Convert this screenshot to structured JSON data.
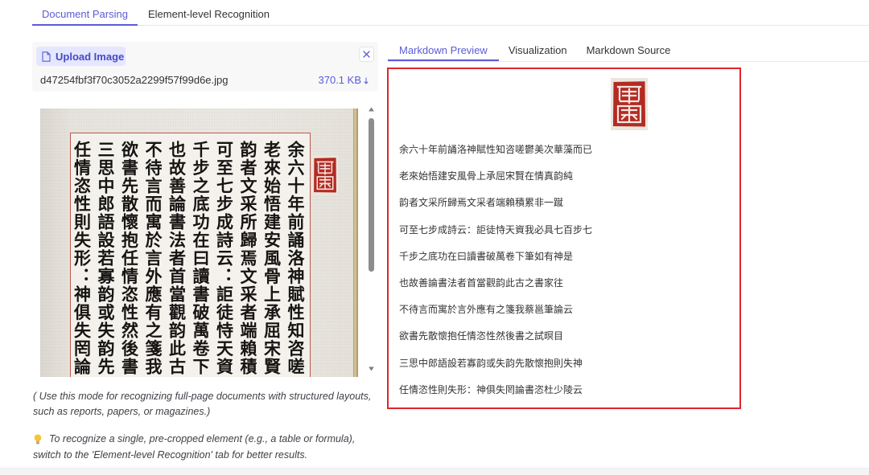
{
  "main_tabs": [
    {
      "label": "Document Parsing",
      "active": true
    },
    {
      "label": "Element-level Recognition",
      "active": false
    }
  ],
  "upload": {
    "button_label": "Upload Image",
    "button_icon": "file-icon",
    "clear_icon": "close-icon",
    "file_name": "d47254fbf3f70c3052a2299f57f99d6e.jpg",
    "file_size": "370.1 KB",
    "download_icon": "download-arrow-icon"
  },
  "image_preview": {
    "seal_icon": "red-seal-stamp",
    "columns": [
      "余六十年前誦洛神賦性知咨嗟",
      "老來始悟建安風骨上承屈宋賢",
      "韵者文采所歸焉文采者端賴積",
      "可至七步成詩云：詎徒恃天資",
      "千步之底功在曰讀書破萬卷下",
      "也故善論書法者首當觀韵此古",
      "不待言而寓於言外應有之箋我",
      "欲書先散懷抱任情恣性然後書",
      "三思中郎語設若寡韵或失韵先",
      "任情恣性則失形：神俱失罔論"
    ]
  },
  "hint_lines": [
    "( Use this mode for recognizing full-page documents with structured layouts,",
    "such as reports, papers, or magazines.)"
  ],
  "tip": {
    "icon": "lightbulb-icon",
    "lines": [
      "To recognize a single, pre-cropped element (e.g., a table or formula),",
      "switch to the 'Element-level Recognition' tab for better results."
    ]
  },
  "output_tabs": [
    {
      "label": "Markdown Preview",
      "active": true
    },
    {
      "label": "Visualization",
      "active": false
    },
    {
      "label": "Markdown Source",
      "active": false
    }
  ],
  "markdown_preview": {
    "image_icon": "red-seal-stamp",
    "lines": [
      "余六十年前誦洛神賦性知咨嗟鬱美次華藻而已",
      "老來始悟建安風骨上承屈宋賢在情真韵純",
      "韵者文采所歸焉文采者端賴積累非一蹴",
      "可至七步成詩云：詎徒恃天資我必具七百步七",
      "千步之底功在曰讀書破萬卷下筆如有神是",
      "也故善論書法者首當觀韵此古之書家往",
      "不待言而寓於言外應有之箋我蔡邕筆論云",
      "欲書先散懷抱任情恣性然後書之試暝目",
      "三思中郎語設若寡韵或失韵先散懷抱則失神",
      "任情恣性則失形：神俱失罔論書恣杜少陵云"
    ]
  },
  "colors": {
    "accent": "#5b5bd6",
    "accent_light_bg": "#e4e7ff",
    "highlight_border": "#e0262c",
    "seal_red": "#b42a22"
  }
}
